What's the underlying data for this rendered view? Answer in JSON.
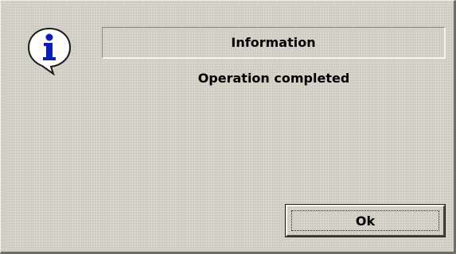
{
  "dialog": {
    "title": "Information",
    "message": "Operation completed",
    "ok_label": "Ok",
    "icon": "info-icon"
  },
  "colors": {
    "background": "#d6d3c9",
    "icon_blue": "#0b1fb8"
  }
}
